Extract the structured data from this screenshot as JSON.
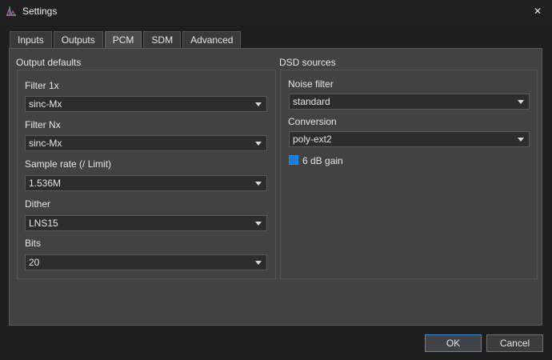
{
  "window": {
    "title": "Settings",
    "close_glyph": "✕"
  },
  "tabs": [
    {
      "label": "Inputs",
      "active": false
    },
    {
      "label": "Outputs",
      "active": false
    },
    {
      "label": "PCM",
      "active": true
    },
    {
      "label": "SDM",
      "active": false
    },
    {
      "label": "Advanced",
      "active": false
    }
  ],
  "output_defaults": {
    "title": "Output defaults",
    "filter_1x": {
      "label": "Filter 1x",
      "value": "sinc-Mx"
    },
    "filter_nx": {
      "label": "Filter Nx",
      "value": "sinc-Mx"
    },
    "sample_rate": {
      "label": "Sample rate (/ Limit)",
      "value": "1.536M"
    },
    "dither": {
      "label": "Dither",
      "value": "LNS15"
    },
    "bits": {
      "label": "Bits",
      "value": "20"
    }
  },
  "dsd_sources": {
    "title": "DSD sources",
    "noise_filter": {
      "label": "Noise filter",
      "value": "standard"
    },
    "conversion": {
      "label": "Conversion",
      "value": "poly-ext2"
    },
    "gain_checkbox": {
      "label": "6 dB gain",
      "checked": true
    }
  },
  "buttons": {
    "ok": "OK",
    "cancel": "Cancel"
  },
  "colors": {
    "accent": "#1e7ad6",
    "panel": "#424242",
    "background": "#1f1f1f"
  }
}
